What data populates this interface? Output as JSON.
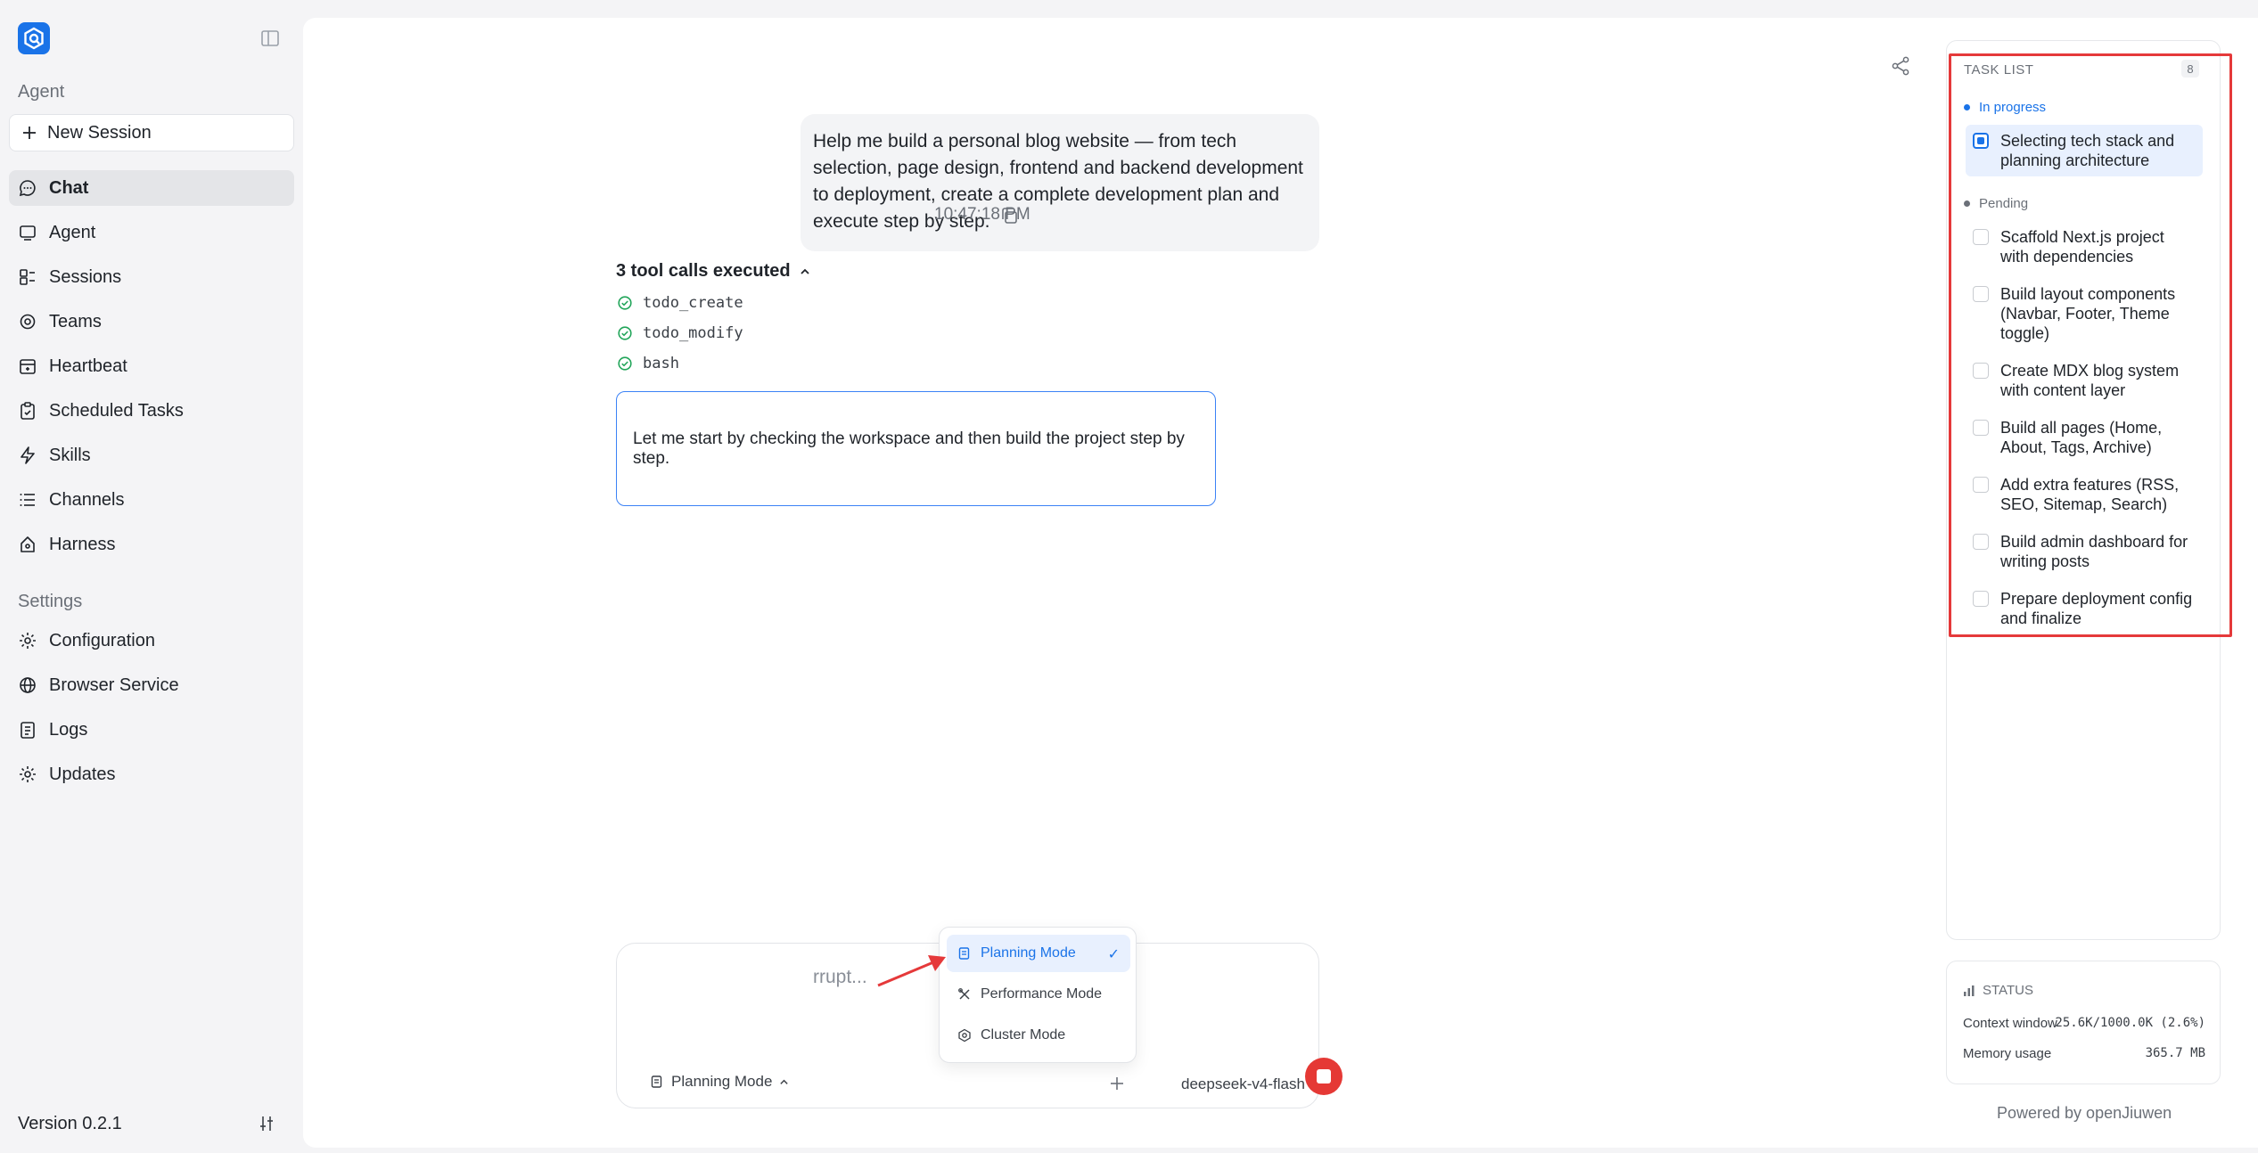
{
  "sidebar": {
    "agent_label": "Agent",
    "new_session_label": "New Session",
    "items": [
      {
        "label": "Chat",
        "icon": "chat-icon"
      },
      {
        "label": "Agent",
        "icon": "monitor-icon"
      },
      {
        "label": "Sessions",
        "icon": "sessions-icon"
      },
      {
        "label": "Teams",
        "icon": "teams-icon"
      },
      {
        "label": "Heartbeat",
        "icon": "heartbeat-icon"
      },
      {
        "label": "Scheduled Tasks",
        "icon": "clipboard-icon"
      },
      {
        "label": "Skills",
        "icon": "lightning-icon"
      },
      {
        "label": "Channels",
        "icon": "list-icon"
      },
      {
        "label": "Harness",
        "icon": "harness-icon"
      }
    ],
    "settings_label": "Settings",
    "settings_items": [
      {
        "label": "Configuration",
        "icon": "gear-icon"
      },
      {
        "label": "Browser Service",
        "icon": "globe-icon"
      },
      {
        "label": "Logs",
        "icon": "logs-icon"
      },
      {
        "label": "Updates",
        "icon": "updates-icon"
      }
    ],
    "version": "Version 0.2.1"
  },
  "chat": {
    "user_message": "Help me build a personal blog website — from tech selection, page design, frontend and backend development to deployment, create a complete development plan and execute step by step.",
    "message_time": "10:47:18 PM",
    "tool_calls_header": "3 tool calls executed",
    "tool_calls": [
      "todo_create",
      "todo_modify",
      "bash"
    ],
    "assistant_message": "Let me start by checking the workspace and then build the project step by step."
  },
  "composer": {
    "placeholder_visible": "rrupt...",
    "mode_label": "Planning Mode",
    "model": "deepseek-v4-flash"
  },
  "mode_menu": {
    "items": [
      "Planning Mode",
      "Performance Mode",
      "Cluster Mode"
    ],
    "selected": "Planning Mode"
  },
  "task_list": {
    "title": "TASK LIST",
    "count": "8",
    "in_progress_label": "In progress",
    "in_progress": [
      "Selecting tech stack and planning architecture"
    ],
    "pending_label": "Pending",
    "pending": [
      "Scaffold Next.js project with dependencies",
      "Build layout components (Navbar, Footer, Theme toggle)",
      "Create MDX blog system with content layer",
      "Build all pages (Home, About, Tags, Archive)",
      "Add extra features (RSS, SEO, Sitemap, Search)",
      "Build admin dashboard for writing posts",
      "Prepare deployment config and finalize"
    ]
  },
  "status": {
    "title": "STATUS",
    "context_label": "Context window",
    "context_value": "25.6K/1000.0K (2.6%)",
    "memory_label": "Memory usage",
    "memory_value": "365.7 MB"
  },
  "footer": {
    "powered_by": "Powered by openJiuwen"
  },
  "colors": {
    "accent": "#1a73e8",
    "stop": "#e53935",
    "highlight": "#e5393a",
    "success": "#22a55a"
  }
}
